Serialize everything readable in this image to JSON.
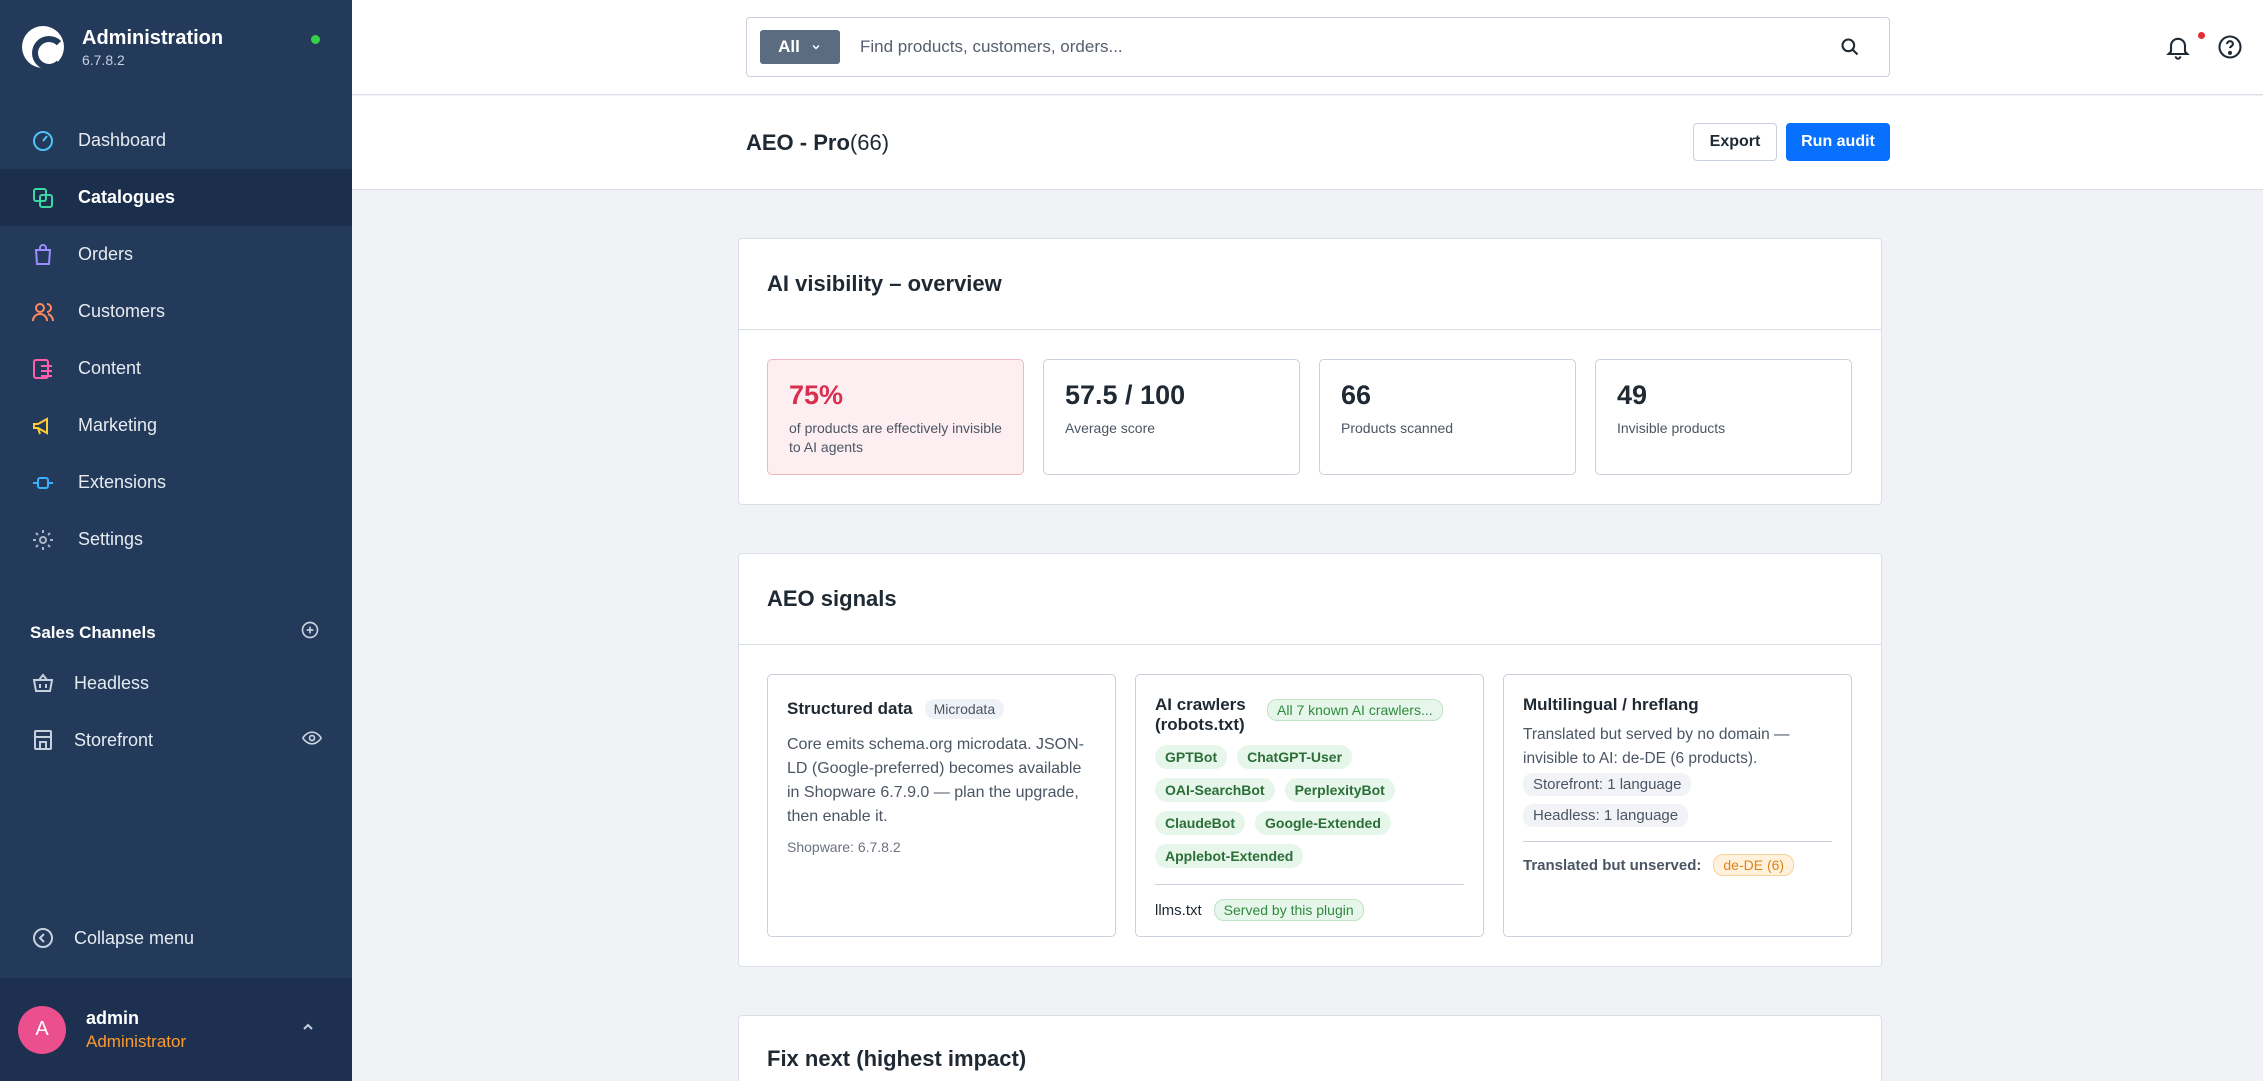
{
  "app": {
    "title": "Administration",
    "version": "6.7.8.2"
  },
  "nav": {
    "items": [
      {
        "label": "Dashboard",
        "icon": "dashboard-icon",
        "color": "#4fc3f7"
      },
      {
        "label": "Catalogues",
        "icon": "catalogue-icon",
        "color": "#3cd6a4",
        "active": true
      },
      {
        "label": "Orders",
        "icon": "orders-icon",
        "color": "#9b8cff"
      },
      {
        "label": "Customers",
        "icon": "customers-icon",
        "color": "#ff8a5c"
      },
      {
        "label": "Content",
        "icon": "content-icon",
        "color": "#ff5fa8"
      },
      {
        "label": "Marketing",
        "icon": "marketing-icon",
        "color": "#ffcc33"
      },
      {
        "label": "Extensions",
        "icon": "extensions-icon",
        "color": "#3ab0ff"
      },
      {
        "label": "Settings",
        "icon": "settings-icon",
        "color": "#aab6c6"
      }
    ]
  },
  "sales_channels": {
    "title": "Sales Channels",
    "items": [
      {
        "label": "Headless",
        "icon": "basket-icon"
      },
      {
        "label": "Storefront",
        "icon": "storefront-icon"
      }
    ]
  },
  "collapse_label": "Collapse menu",
  "user": {
    "initial": "A",
    "name": "admin",
    "role": "Administrator"
  },
  "search": {
    "scope": "All",
    "placeholder": "Find products, customers, orders..."
  },
  "page": {
    "title": "AEO - Pro",
    "count": "(66)",
    "export_label": "Export",
    "run_label": "Run audit"
  },
  "overview": {
    "title": "AI visibility – overview",
    "stats": [
      {
        "value": "75%",
        "label": "of products are effectively invisible to AI agents"
      },
      {
        "value": "57.5 / 100",
        "label": "Average score"
      },
      {
        "value": "66",
        "label": "Products scanned"
      },
      {
        "value": "49",
        "label": "Invisible products"
      }
    ]
  },
  "signals": {
    "title": "AEO signals",
    "structured": {
      "title": "Structured data",
      "tag": "Microdata",
      "text": "Core emits schema.org microdata. JSON-LD (Google-preferred) becomes available in Shopware 6.7.9.0 — plan the upgrade, then enable it.",
      "meta": "Shopware: 6.7.8.2"
    },
    "crawlers": {
      "title": "AI crawlers (robots.txt)",
      "tag": "All 7 known AI crawlers...",
      "bots": [
        "GPTBot",
        "ChatGPT-User",
        "OAI-SearchBot",
        "PerplexityBot",
        "ClaudeBot",
        "Google-Extended",
        "Applebot-Extended"
      ],
      "llms_label": "llms.txt",
      "llms_tag": "Served by this plugin"
    },
    "multilingual": {
      "title": "Multilingual / hreflang",
      "text": "Translated but served by no domain — invisible to AI: de-DE (6 products).",
      "langs": [
        "Storefront: 1 language",
        "Headless: 1 language"
      ],
      "unserved_label": "Translated but unserved:",
      "unserved_tag": "de-DE (6)"
    }
  },
  "fix_next": {
    "title": "Fix next (highest impact)"
  }
}
